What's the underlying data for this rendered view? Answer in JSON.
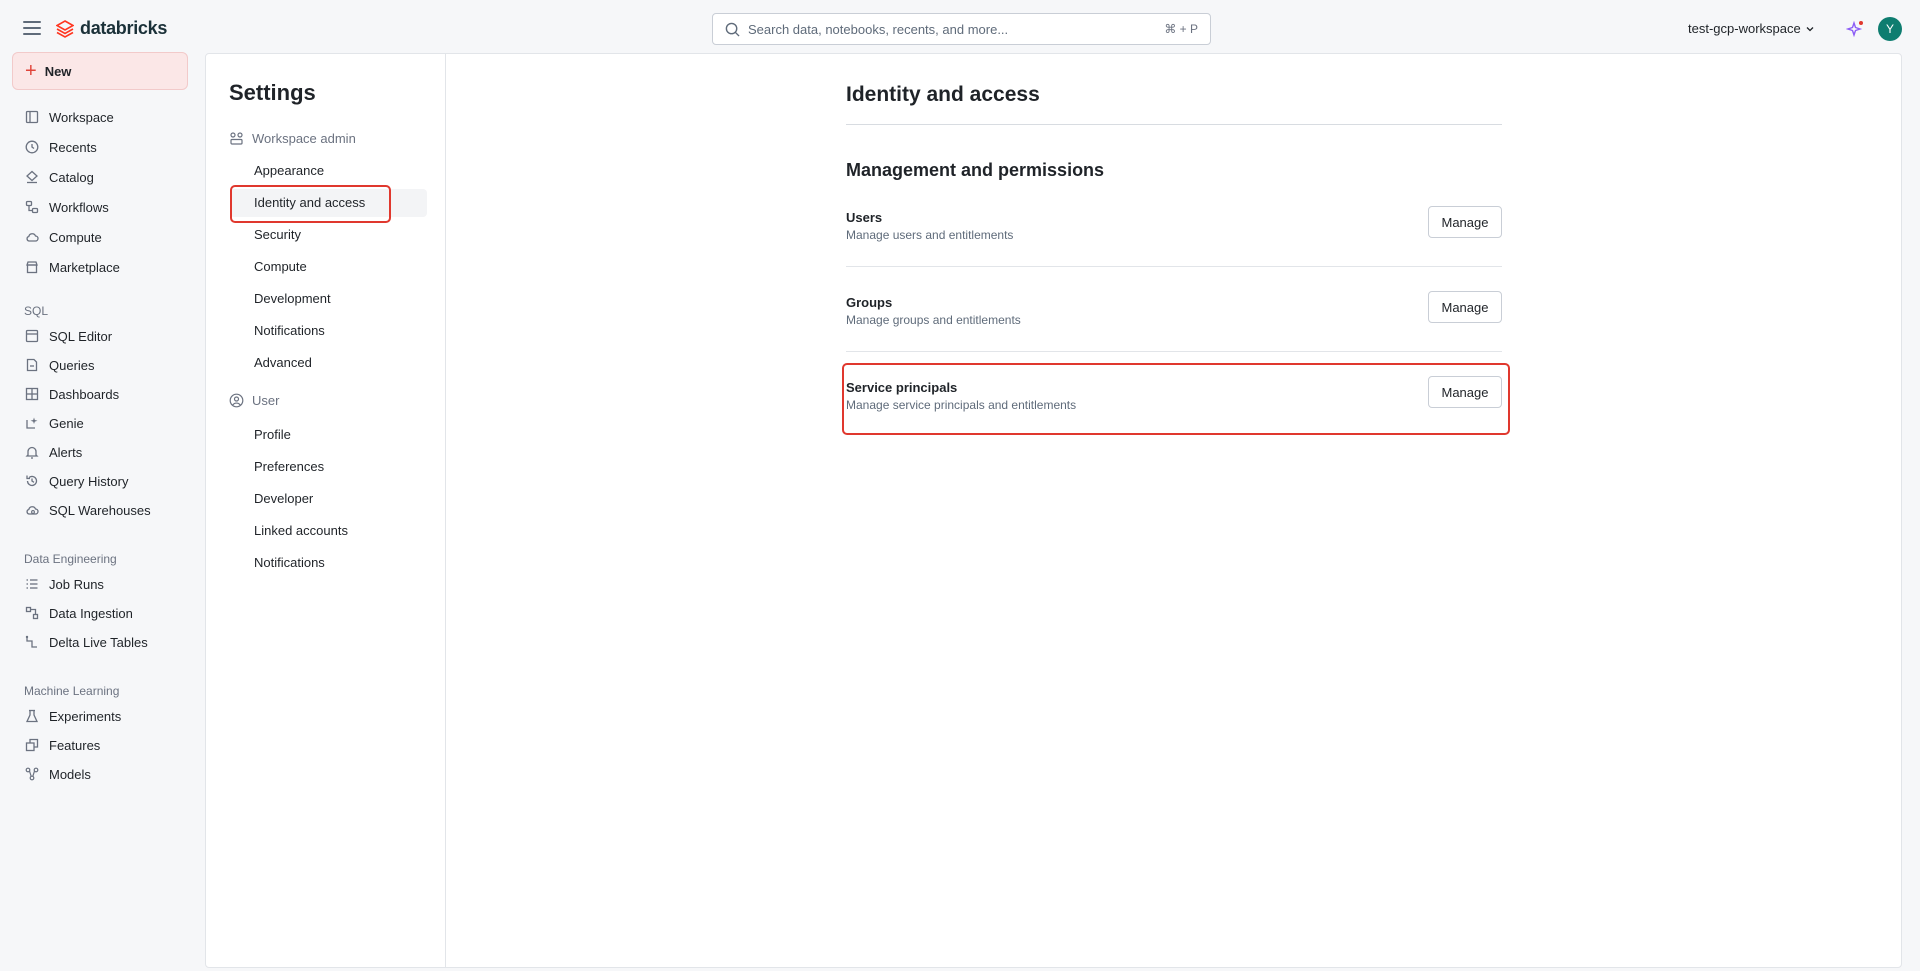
{
  "topbar": {
    "logo_text": "databricks",
    "search_placeholder": "Search data, notebooks, recents, and more...",
    "search_shortcut": "⌘ + P",
    "workspace_name": "test-gcp-workspace",
    "avatar_initial": "Y"
  },
  "leftnav": {
    "new_label": "New",
    "main_items": [
      {
        "label": "Workspace",
        "icon": "folder-icon"
      },
      {
        "label": "Recents",
        "icon": "clock-icon"
      },
      {
        "label": "Catalog",
        "icon": "catalog-icon"
      },
      {
        "label": "Workflows",
        "icon": "workflows-icon"
      },
      {
        "label": "Compute",
        "icon": "cloud-icon"
      },
      {
        "label": "Marketplace",
        "icon": "store-icon"
      }
    ],
    "sql_section": "SQL",
    "sql_items": [
      {
        "label": "SQL Editor",
        "icon": "editor-icon"
      },
      {
        "label": "Queries",
        "icon": "query-icon"
      },
      {
        "label": "Dashboards",
        "icon": "dashboard-icon"
      },
      {
        "label": "Genie",
        "icon": "genie-icon"
      },
      {
        "label": "Alerts",
        "icon": "bell-icon"
      },
      {
        "label": "Query History",
        "icon": "history-icon"
      },
      {
        "label": "SQL Warehouses",
        "icon": "warehouse-icon"
      }
    ],
    "de_section": "Data Engineering",
    "de_items": [
      {
        "label": "Job Runs",
        "icon": "list-icon"
      },
      {
        "label": "Data Ingestion",
        "icon": "ingestion-icon"
      },
      {
        "label": "Delta Live Tables",
        "icon": "pipeline-icon"
      }
    ],
    "ml_section": "Machine Learning",
    "ml_items": [
      {
        "label": "Experiments",
        "icon": "flask-icon"
      },
      {
        "label": "Features",
        "icon": "features-icon"
      },
      {
        "label": "Models",
        "icon": "models-icon"
      }
    ]
  },
  "settings": {
    "title": "Settings",
    "workspace_admin_label": "Workspace admin",
    "workspace_admin_items": [
      "Appearance",
      "Identity and access",
      "Security",
      "Compute",
      "Development",
      "Notifications",
      "Advanced"
    ],
    "user_label": "User",
    "user_items": [
      "Profile",
      "Preferences",
      "Developer",
      "Linked accounts",
      "Notifications"
    ]
  },
  "content": {
    "heading": "Identity and access",
    "section": "Management and permissions",
    "rows": [
      {
        "title": "Users",
        "desc": "Manage users and entitlements",
        "button": "Manage"
      },
      {
        "title": "Groups",
        "desc": "Manage groups and entitlements",
        "button": "Manage"
      },
      {
        "title": "Service principals",
        "desc": "Manage service principals and entitlements",
        "button": "Manage"
      }
    ]
  },
  "colors": {
    "accent_red": "#e0382e",
    "avatar_teal": "#0e7d70"
  }
}
